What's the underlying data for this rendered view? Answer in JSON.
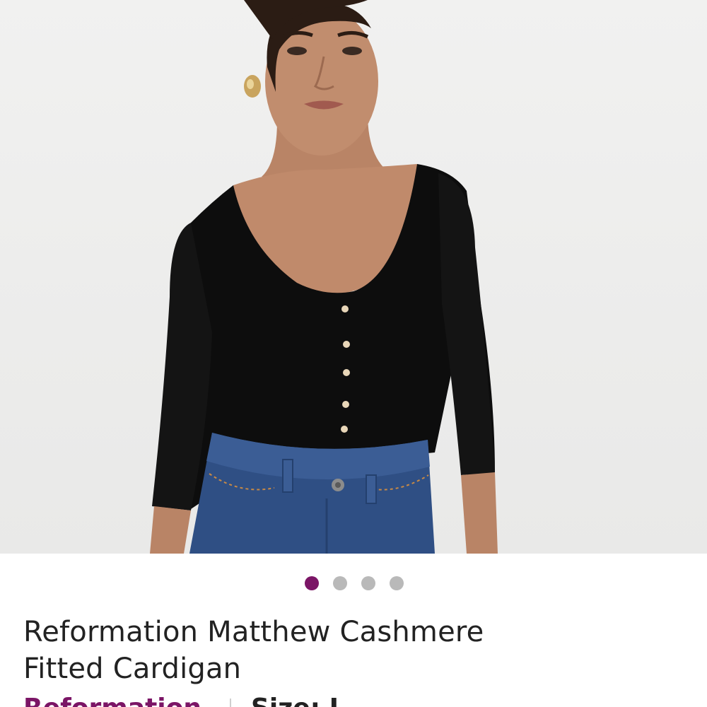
{
  "carousel": {
    "slide_count": 4,
    "active_index": 0
  },
  "product": {
    "title_line1": "Reformation Matthew Cashmere",
    "title_line2": "Fitted Cardigan",
    "brand": "Reformation",
    "size_label": "Size: L"
  },
  "colors": {
    "accent": "#7b1566",
    "dot_inactive": "#b9b9b9",
    "text": "#222222"
  },
  "icons": {
    "dot": "carousel-dot-icon"
  }
}
